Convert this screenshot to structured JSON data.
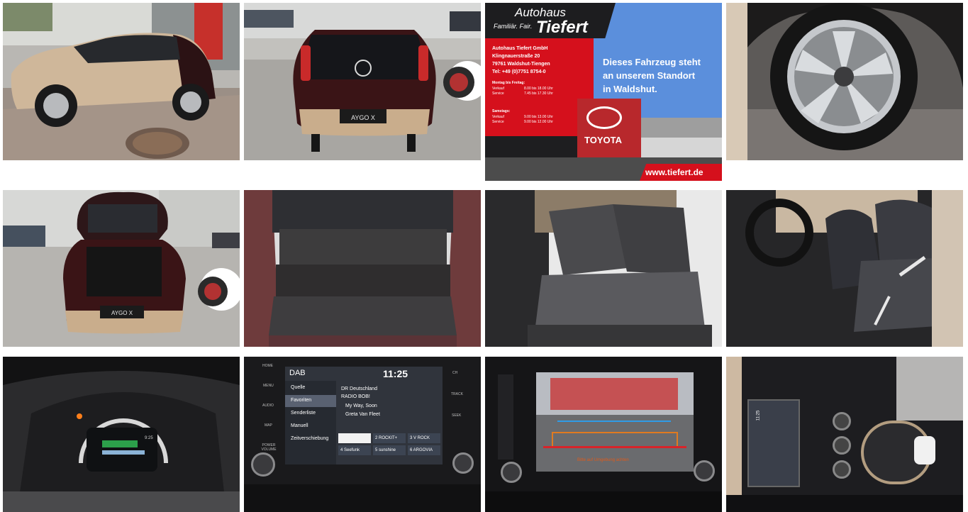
{
  "gallery": {
    "tiles": [
      {
        "name": "photo-exterior-side"
      },
      {
        "name": "photo-exterior-rear",
        "plate": "AYGO X"
      },
      {
        "name": "dealer-ad"
      },
      {
        "name": "photo-wheel"
      },
      {
        "name": "photo-trunk-open",
        "plate": "AYGO X"
      },
      {
        "name": "photo-trunk-interior"
      },
      {
        "name": "photo-rear-seats"
      },
      {
        "name": "photo-front-seats"
      },
      {
        "name": "photo-instrument-cluster"
      },
      {
        "name": "photo-infotainment-radio"
      },
      {
        "name": "photo-rear-camera"
      },
      {
        "name": "photo-center-console"
      }
    ]
  },
  "dealer_ad": {
    "brand_line1": "Autohaus",
    "brand_line2_small": "Familiär. Fair.",
    "brand_line2_big": "Tiefert",
    "company": "Autohaus Tiefert GmbH",
    "street": "Klingnauerstraße 20",
    "city": "79761 Waldshut-Tiengen",
    "phone": "Tel: +49 (0)7751 8754-0",
    "hours_weekday_title": "Montag bis Freitag:",
    "hours_weekday": [
      {
        "label": "Verkauf",
        "time": "8.00 bis 18.00 Uhr"
      },
      {
        "label": "Service",
        "time": "7.45 bis 17.30 Uhr"
      }
    ],
    "hours_sat_title": "Samstags:",
    "hours_sat": [
      {
        "label": "Verkauf",
        "time": "9.00 bis 13.00 Uhr"
      },
      {
        "label": "Service",
        "time": "9.00 bis 12.00 Uhr"
      }
    ],
    "slogan_line1": "Dieses Fahrzeug steht",
    "slogan_line2": "an unserem Standort",
    "slogan_line3": "in Waldshut.",
    "building_sign": "TOYOTA",
    "url": "www.tiefert.de"
  },
  "radio_screen": {
    "source": "DAB",
    "time": "11:25",
    "menu": [
      "Quelle",
      "Favoriten",
      "Senderliste",
      "Manuell",
      "Zeitverschiebung"
    ],
    "station_line1": "DR Deutschland",
    "station_line2": "RADIO BOB!",
    "song": "My Way, Soon",
    "artist": "Greta Van Fleet",
    "presets": [
      "",
      "2 ROCKIT+",
      "3 V ROCK",
      "4 Seefunk",
      "5 sunshine",
      "6 ARGOVIA"
    ],
    "side_buttons_left": [
      "HOME",
      "MENU",
      "AUDIO",
      "MAP",
      "POWER VOLUME"
    ],
    "side_buttons_right": [
      "CH",
      "TRACK",
      "SEEK"
    ]
  },
  "cluster": {
    "speed_small": "9:25"
  },
  "camera": {
    "warning": "Bitte auf Umgebung achten"
  },
  "console_screen": {
    "time": "11:25"
  },
  "colors": {
    "dealer_red": "#d5101c",
    "dealer_sky": "#4e86d6",
    "car_beige": "#c9b094",
    "car_maroon": "#3a1416",
    "toyota_red": "#c8102e"
  }
}
